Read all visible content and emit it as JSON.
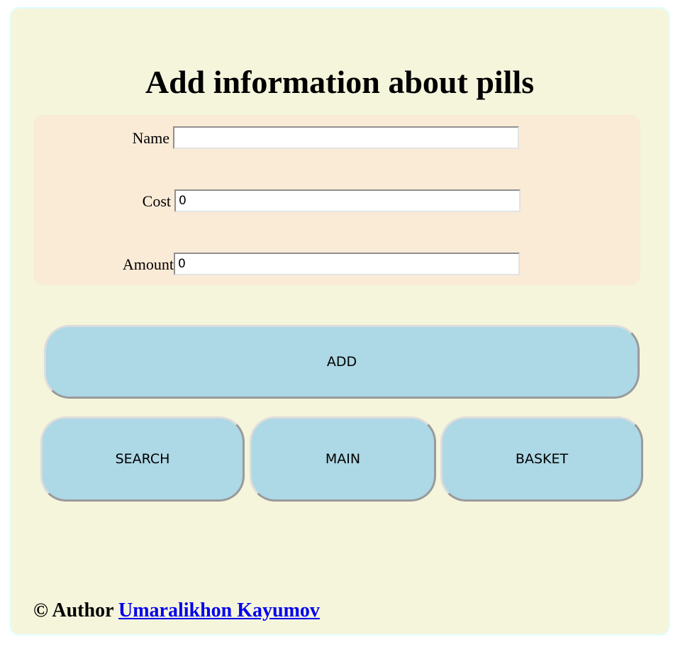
{
  "page": {
    "title": "Add information about pills"
  },
  "form": {
    "name": {
      "label": "Name",
      "value": ""
    },
    "cost": {
      "label": "Cost",
      "value": "0"
    },
    "amount": {
      "label": "Amount",
      "value": "0"
    }
  },
  "buttons": {
    "add": "ADD",
    "search": "SEARCH",
    "main": "MAIN",
    "basket": "BASKET"
  },
  "footer": {
    "prefix": "© Author",
    "author_link": "Umaralikhon Kayumov"
  },
  "colors": {
    "card_background": "#f5f5dc",
    "form_panel_background": "#faebd7",
    "button_background": "#add8e6",
    "link": "#0000ee"
  }
}
